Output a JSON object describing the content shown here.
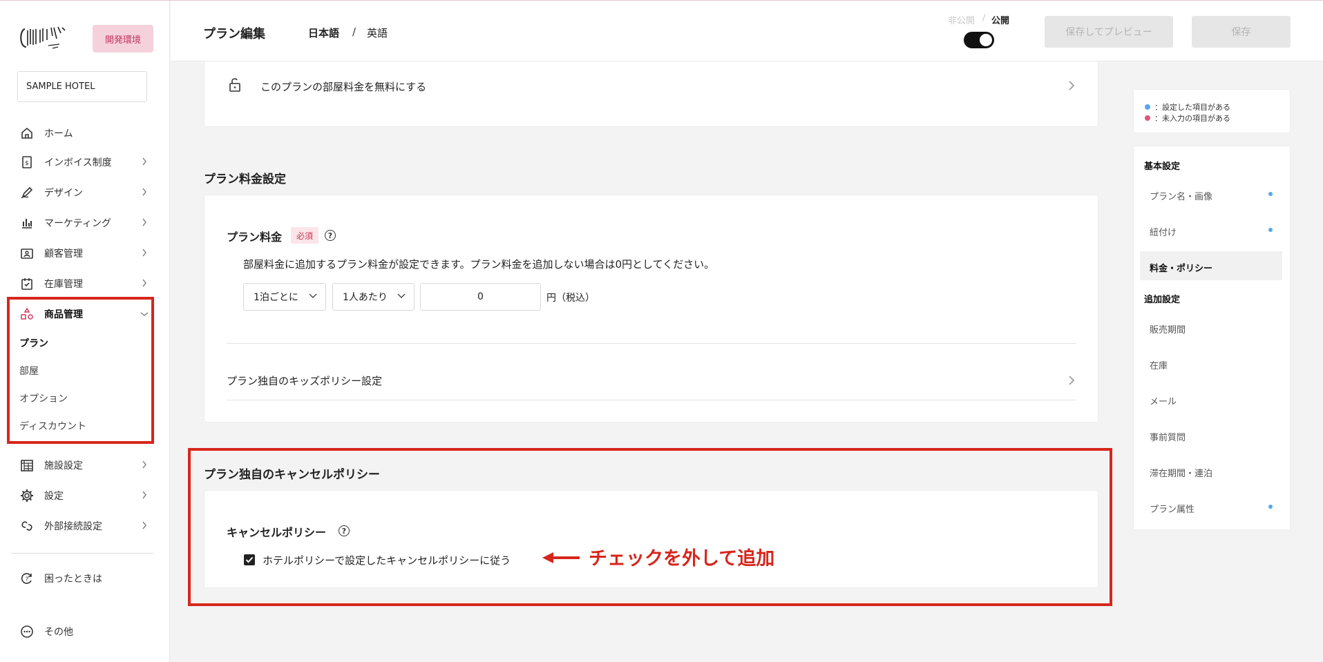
{
  "sidebar": {
    "env_badge": "開発環境",
    "hotel": "SAMPLE HOTEL",
    "items": [
      {
        "label": "ホーム"
      },
      {
        "label": "インボイス制度"
      },
      {
        "label": "デザイン"
      },
      {
        "label": "マーケティング"
      },
      {
        "label": "顧客管理"
      },
      {
        "label": "在庫管理"
      },
      {
        "label": "商品管理"
      },
      {
        "label": "施設設定"
      },
      {
        "label": "設定"
      },
      {
        "label": "外部接続設定"
      }
    ],
    "sub_items": [
      {
        "label": "プラン"
      },
      {
        "label": "部屋"
      },
      {
        "label": "オプション"
      },
      {
        "label": "ディスカウント"
      }
    ],
    "help": "困ったときは",
    "other": "その他"
  },
  "header": {
    "title": "プラン編集",
    "lang_ja": "日本語",
    "lang_sep": "/",
    "lang_en": "英語",
    "unpublished": "非公開",
    "pub_sep": "/",
    "published": "公開",
    "preview_button": "保存してプレビュー",
    "save_button": "保存"
  },
  "main": {
    "free_room_row": "このプランの部屋料金を無料にする",
    "price_section_title": "プラン料金設定",
    "price_label": "プラン料金",
    "required_badge": "必須",
    "price_description": "部屋料金に追加するプラン料金が設定できます。プラン料金を追加しない場合は0円としてください。",
    "per_night_select": "1泊ごとに",
    "per_person_select": "1人あたり",
    "price_value": "0",
    "price_unit": "円（税込）",
    "kids_policy_row": "プラン独自のキッズポリシー設定",
    "cancel_section_title": "プラン独自のキャンセルポリシー",
    "cancel_label": "キャンセルポリシー",
    "cancel_checkbox_label": "ホテルポリシーで設定したキャンセルポリシーに従う",
    "annotation": "チェックを外して追加"
  },
  "right_nav": {
    "legend_set": "：設定した項目がある",
    "legend_missing": "：未入力の項目がある",
    "basic_group": "基本設定",
    "plan_name_image": "プラン名・画像",
    "linking": "紐付け",
    "price_policy": "料金・ポリシー",
    "additional_group": "追加設定",
    "sales_period": "販売期間",
    "inventory": "在庫",
    "mail": "メール",
    "pre_questions": "事前質問",
    "stay_period": "滞在期間・連泊",
    "plan_attributes": "プラン属性"
  },
  "colors": {
    "accent_red": "#d7261c",
    "dot_blue": "#5ba6ea",
    "dot_pink": "#e5557a",
    "env_badge_bg": "#f5d1db"
  }
}
